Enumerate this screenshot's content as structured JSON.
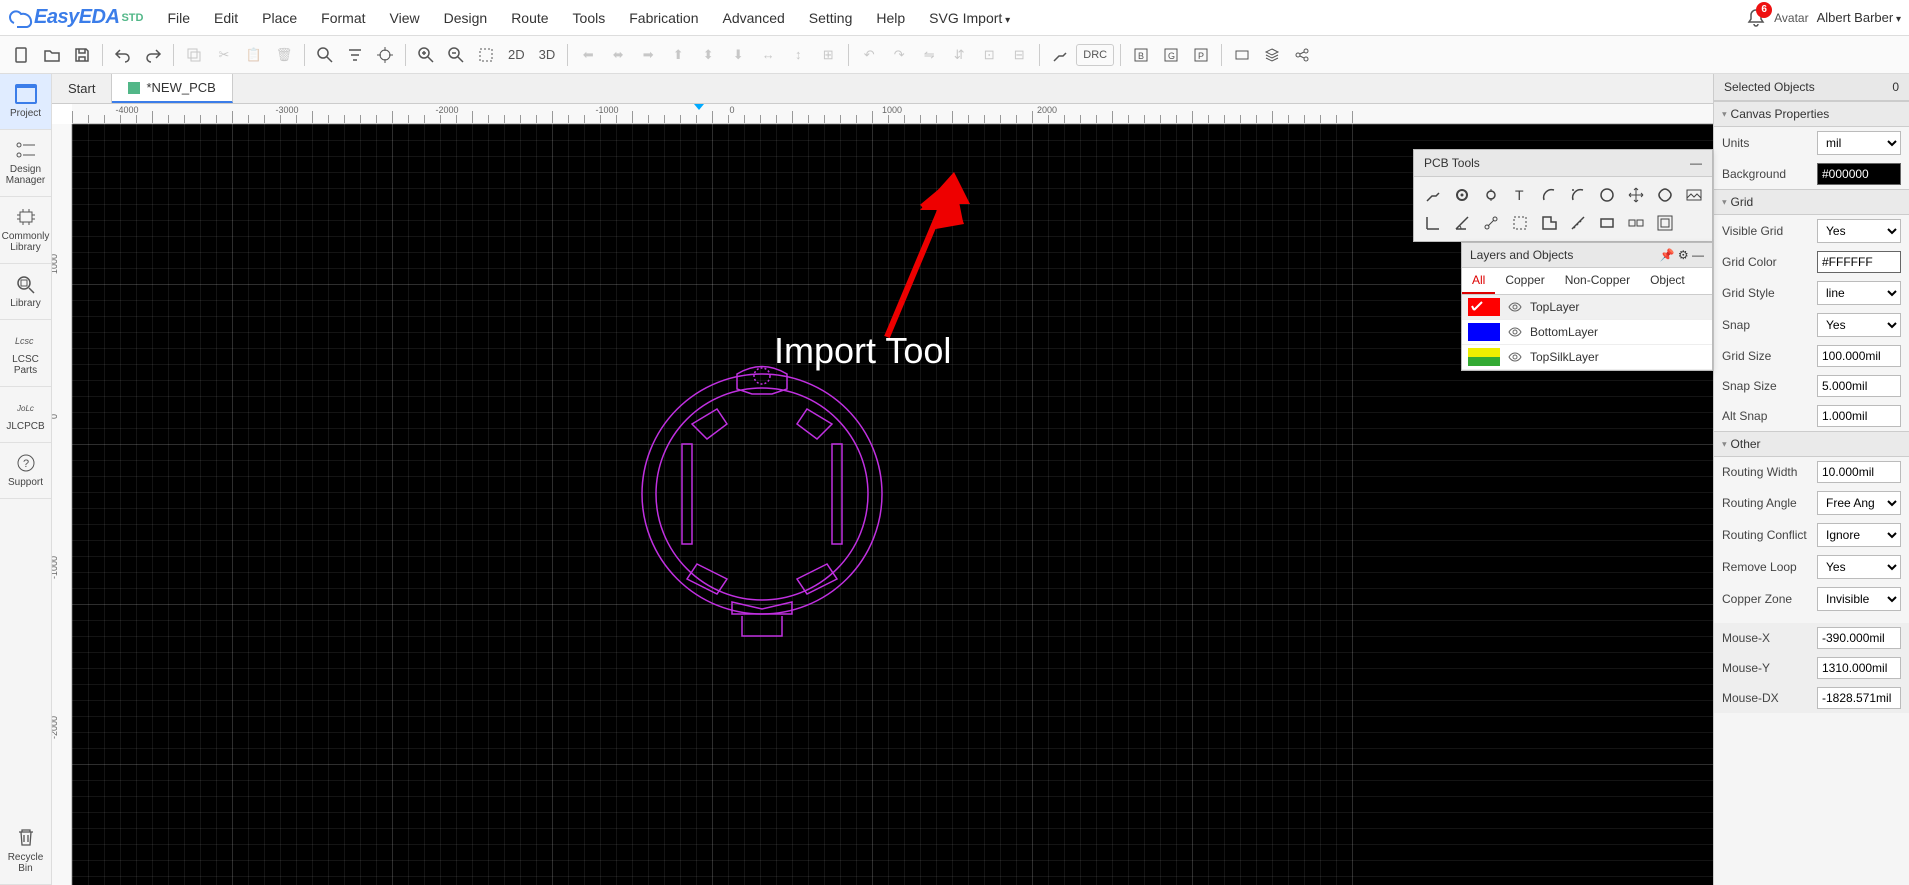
{
  "app": {
    "name": "EasyEDA",
    "edition": "STD"
  },
  "menu": [
    "File",
    "Edit",
    "Place",
    "Format",
    "View",
    "Design",
    "Route",
    "Tools",
    "Fabrication",
    "Advanced",
    "Setting",
    "Help",
    "SVG Import"
  ],
  "user": {
    "avatar_label": "Avatar",
    "name": "Albert Barber",
    "notifications": 6
  },
  "toolbar": {
    "view2d": "2D",
    "view3d": "3D",
    "drc": "DRC"
  },
  "tabs": {
    "start": "Start",
    "current": "*NEW_PCB"
  },
  "leftbar": [
    "Project",
    "Design Manager",
    "Commonly Library",
    "Library",
    "LCSC Parts",
    "JLCPCB",
    "Support",
    "Recycle Bin"
  ],
  "ruler_h": [
    -4000,
    -3000,
    -2000,
    -1000,
    0,
    1000,
    2000
  ],
  "ruler_v": [
    1000,
    0,
    -1000,
    -2000
  ],
  "annotation": "Import Tool",
  "pcb_tools": {
    "title": "PCB Tools"
  },
  "layers": {
    "title": "Layers and Objects",
    "tabs": [
      "All",
      "Copper",
      "Non-Copper",
      "Object"
    ],
    "rows": [
      {
        "name": "TopLayer",
        "color": "#ff0000",
        "selected": true,
        "pencil": true
      },
      {
        "name": "BottomLayer",
        "color": "#0000ff"
      },
      {
        "name": "TopSilkLayer",
        "color": "#eeee00"
      }
    ]
  },
  "right": {
    "selected_label": "Selected Objects",
    "selected_count": 0,
    "sections": {
      "canvas": "Canvas Properties",
      "grid": "Grid",
      "other": "Other"
    },
    "props": {
      "units_label": "Units",
      "units": "mil",
      "background_label": "Background",
      "background": "#000000",
      "visible_grid_label": "Visible Grid",
      "visible_grid": "Yes",
      "grid_color_label": "Grid Color",
      "grid_color": "#FFFFFF",
      "grid_style_label": "Grid Style",
      "grid_style": "line",
      "snap_label": "Snap",
      "snap": "Yes",
      "grid_size_label": "Grid Size",
      "grid_size": "100.000mil",
      "snap_size_label": "Snap Size",
      "snap_size": "5.000mil",
      "alt_snap_label": "Alt Snap",
      "alt_snap": "1.000mil",
      "routing_width_label": "Routing Width",
      "routing_width": "10.000mil",
      "routing_angle_label": "Routing Angle",
      "routing_angle": "Free Ang",
      "routing_conflict_label": "Routing Conflict",
      "routing_conflict": "Ignore",
      "remove_loop_label": "Remove Loop",
      "remove_loop": "Yes",
      "copper_zone_label": "Copper Zone",
      "copper_zone": "Invisible",
      "mouse_x_label": "Mouse-X",
      "mouse_x": "-390.000mil",
      "mouse_y_label": "Mouse-Y",
      "mouse_y": "1310.000mil",
      "mouse_dx_label": "Mouse-DX",
      "mouse_dx": "-1828.571mil"
    }
  }
}
